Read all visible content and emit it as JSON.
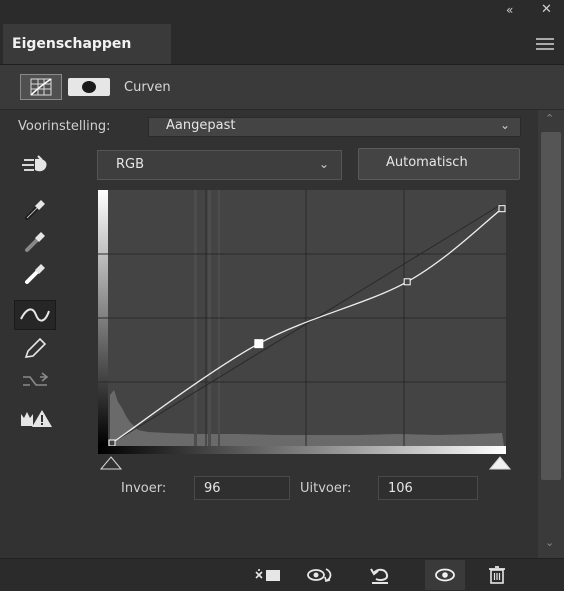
{
  "window": {
    "collapse_glyph": "«",
    "close_glyph": "✕"
  },
  "panel": {
    "tab_title": "Eigenschappen",
    "adjustment_name": "Curven"
  },
  "preset": {
    "label": "Voorinstelling:",
    "value": "Aangepast"
  },
  "channel": {
    "value": "RGB"
  },
  "auto_button": {
    "label": "Automatisch"
  },
  "tools": [
    {
      "name": "on-image-adjust-icon"
    },
    {
      "name": "black-point-eyedropper-icon"
    },
    {
      "name": "gray-point-eyedropper-icon"
    },
    {
      "name": "white-point-eyedropper-icon"
    },
    {
      "name": "edit-points-curve-icon",
      "active": true
    },
    {
      "name": "draw-pencil-icon"
    },
    {
      "name": "smooth-curve-icon"
    },
    {
      "name": "clipping-warning-icon"
    }
  ],
  "curve": {
    "input_label": "Invoer:",
    "input_value": "96",
    "output_label": "Uitvoer:",
    "output_value": "106",
    "points": [
      {
        "input": 0,
        "output": 0
      },
      {
        "input": 96,
        "output": 106
      },
      {
        "input": 193,
        "output": 172
      },
      {
        "input": 255,
        "output": 250
      }
    ],
    "selected_point_index": 1
  },
  "footer": {
    "icons": [
      "clip-to-layer-icon",
      "view-previous-state-icon",
      "reset-icon",
      "visibility-eye-icon",
      "trash-icon"
    ]
  },
  "colors": {
    "panel_bg": "#323232",
    "graph_bg": "#424242",
    "curve_line": "#eeeeee",
    "grid_line": "#2a2a2a"
  }
}
